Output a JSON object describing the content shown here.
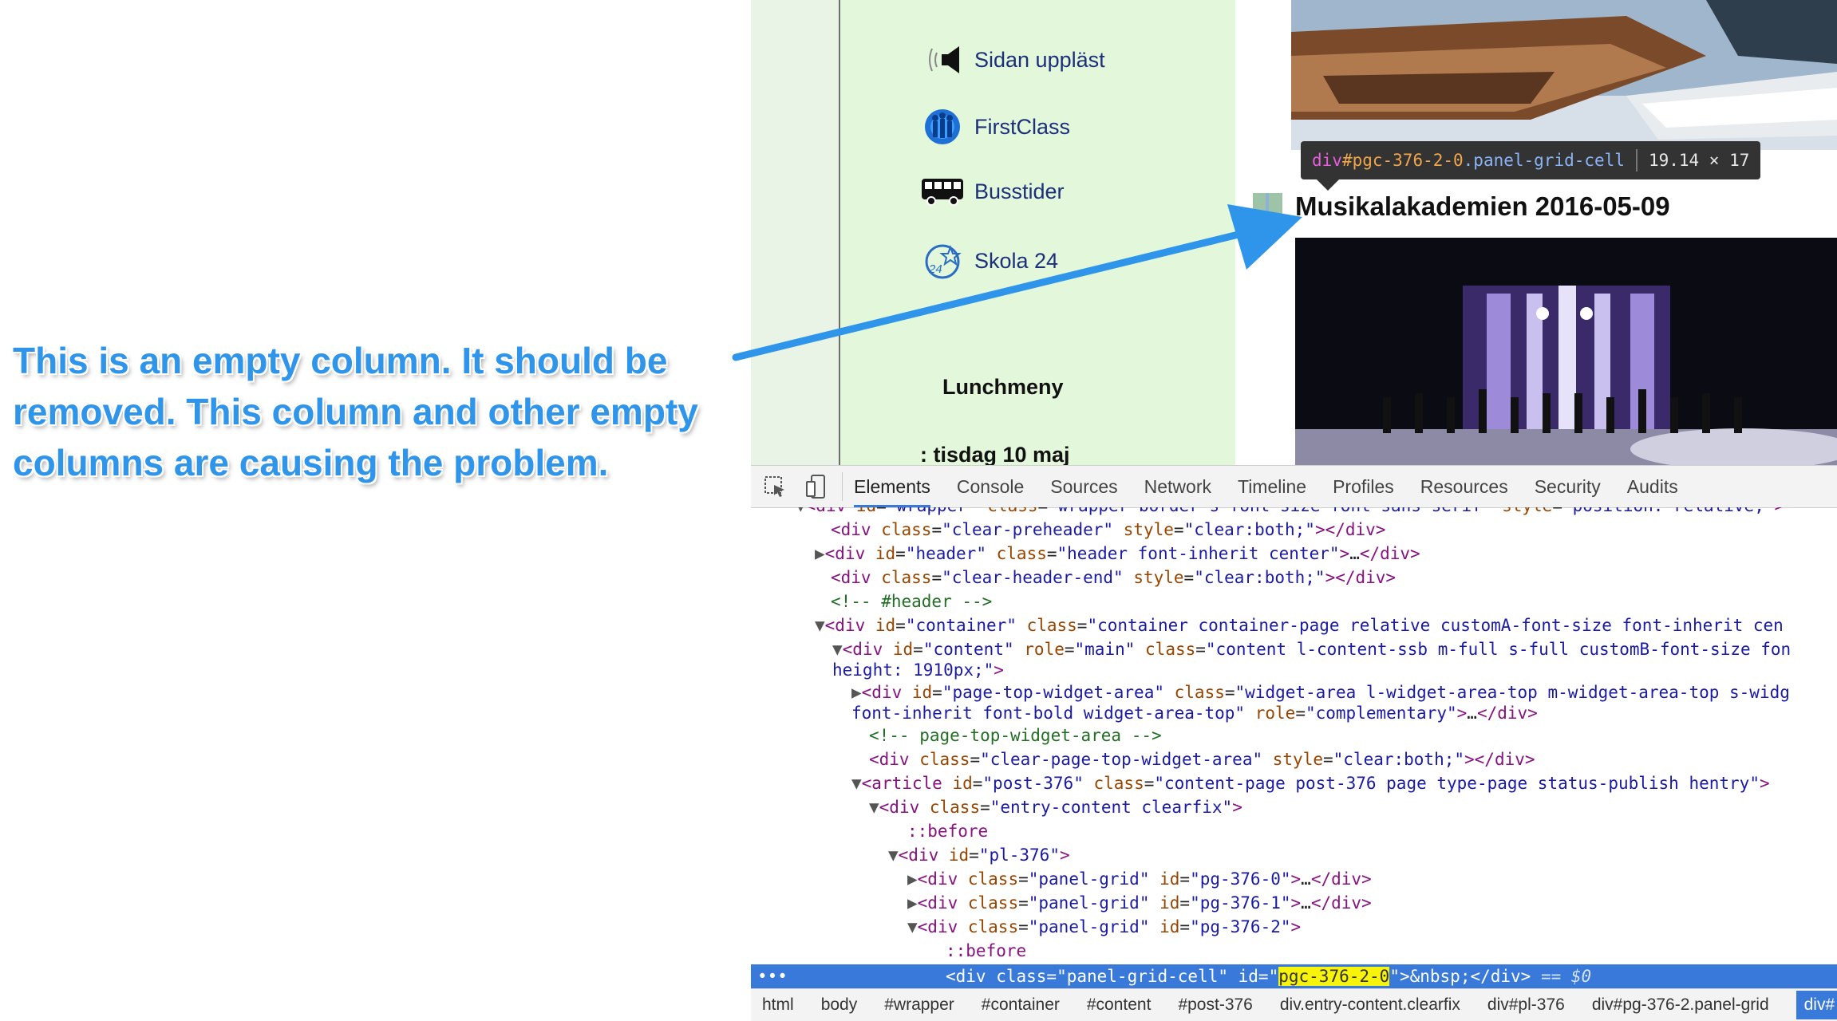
{
  "annotation": {
    "line1": "This is an empty column. It should be",
    "line2": "removed. This column and other empty",
    "line3": "columns are causing the problem."
  },
  "sidebar": {
    "links": [
      {
        "label": "Sidan uppläst",
        "icon": "speaker-icon"
      },
      {
        "label": "FirstClass",
        "icon": "firstclass-icon"
      },
      {
        "label": "Busstider",
        "icon": "bus-icon"
      },
      {
        "label": "Skola 24",
        "icon": "skola24-icon"
      }
    ],
    "lunch_title": "Lunchmeny",
    "lunch_day": ": tisdag 10 maj"
  },
  "article": {
    "title": "Musikalakademien 2016-05-09"
  },
  "tooltip": {
    "tag": "div",
    "id": "#pgc-376-2-0",
    "class": ".panel-grid-cell",
    "size": "19.14 × 17"
  },
  "devtools": {
    "tabs": [
      "Elements",
      "Console",
      "Sources",
      "Network",
      "Timeline",
      "Profiles",
      "Resources",
      "Security",
      "Audits"
    ],
    "active_tab": "Elements",
    "breadcrumbs": [
      "html",
      "body",
      "#wrapper",
      "#container",
      "#content",
      "#post-376",
      "div.entry-content.clearfix",
      "div#pl-376",
      "div#pg-376-2.panel-grid",
      "div#"
    ],
    "selected": {
      "dots": "•••",
      "pre": "<div class=\"panel-grid-cell\" id=\"",
      "hl": "pgc-376-2-0",
      "post": "\">&nbsp;</div>",
      "tail": " == $0"
    }
  }
}
